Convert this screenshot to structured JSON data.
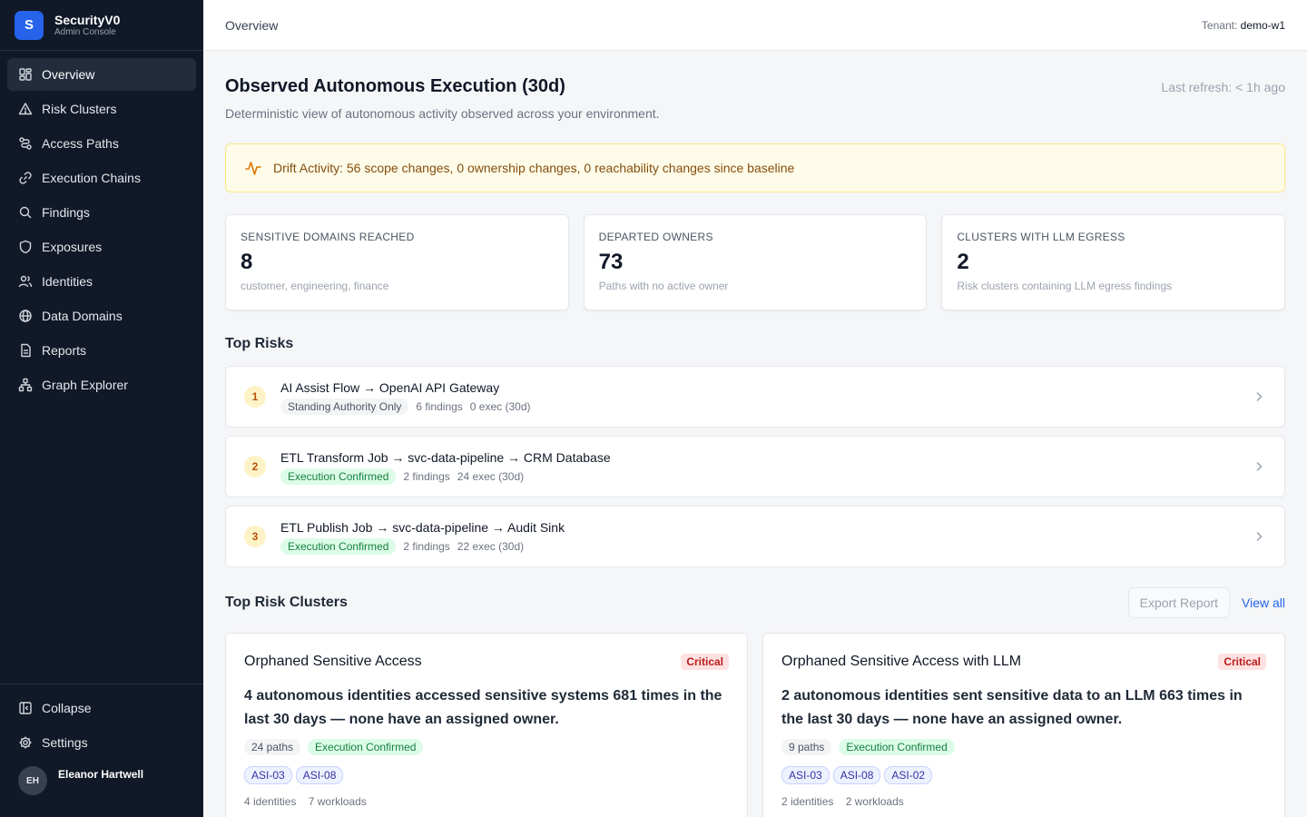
{
  "brand": {
    "logo": "S",
    "name": "SecurityV0",
    "subtitle": "Admin Console"
  },
  "sidebar": {
    "items": [
      {
        "label": "Overview",
        "icon": "dashboard-icon",
        "active": true
      },
      {
        "label": "Risk Clusters",
        "icon": "warning-triangle-icon"
      },
      {
        "label": "Access Paths",
        "icon": "route-icon"
      },
      {
        "label": "Execution Chains",
        "icon": "link-icon"
      },
      {
        "label": "Findings",
        "icon": "search-icon"
      },
      {
        "label": "Exposures",
        "icon": "shield-icon"
      },
      {
        "label": "Identities",
        "icon": "users-icon"
      },
      {
        "label": "Data Domains",
        "icon": "globe-icon"
      },
      {
        "label": "Reports",
        "icon": "document-icon"
      },
      {
        "label": "Graph Explorer",
        "icon": "network-icon"
      }
    ],
    "collapse_label": "Collapse",
    "settings_label": "Settings",
    "user": {
      "initials": "EH",
      "name": "Eleanor Hartwell"
    }
  },
  "header": {
    "breadcrumb": "Overview",
    "tenant_label": "Tenant:",
    "tenant_value": "demo-w1"
  },
  "page": {
    "title": "Observed Autonomous Execution (30d)",
    "subtitle": "Deterministic view of autonomous activity observed across your environment.",
    "last_refresh": "Last refresh: < 1h ago"
  },
  "drift": {
    "text": "Drift Activity: 56 scope changes, 0 ownership changes, 0 reachability changes since baseline",
    "icon": "activity-pulse-icon"
  },
  "stats": [
    {
      "label": "SENSITIVE DOMAINS REACHED",
      "value": "8",
      "desc": "customer, engineering, finance"
    },
    {
      "label": "DEPARTED OWNERS",
      "value": "73",
      "desc": "Paths with no active owner"
    },
    {
      "label": "CLUSTERS WITH LLM EGRESS",
      "value": "2",
      "desc": "Risk clusters containing LLM egress findings"
    }
  ],
  "top_risks": {
    "title": "Top Risks",
    "items": [
      {
        "rank": "1",
        "name": "AI Assist Flow → OpenAI API Gateway",
        "status": "Standing Authority Only",
        "status_type": "gray",
        "findings": "6 findings",
        "exec": "0 exec (30d)"
      },
      {
        "rank": "2",
        "name": "ETL Transform Job → svc-data-pipeline → CRM Database",
        "status": "Execution Confirmed",
        "status_type": "green",
        "findings": "2 findings",
        "exec": "24 exec (30d)"
      },
      {
        "rank": "3",
        "name": "ETL Publish Job → svc-data-pipeline → Audit Sink",
        "status": "Execution Confirmed",
        "status_type": "green",
        "findings": "2 findings",
        "exec": "22 exec (30d)"
      }
    ]
  },
  "clusters": {
    "title": "Top Risk Clusters",
    "export_label": "Export Report",
    "view_all_label": "View all",
    "items": [
      {
        "name": "Orphaned Sensitive Access",
        "severity": "Critical",
        "summary": "4 autonomous identities accessed sensitive systems 681 times in the last 30 days — none have an assigned owner.",
        "paths": "24 paths",
        "status": "Execution Confirmed",
        "asi": [
          "ASI-03",
          "ASI-08"
        ],
        "identities": "4 identities",
        "workloads": "7 workloads"
      },
      {
        "name": "Orphaned Sensitive Access with LLM",
        "severity": "Critical",
        "summary": "2 autonomous identities sent sensitive data to an LLM 663 times in the last 30 days — none have an assigned owner.",
        "paths": "9 paths",
        "status": "Execution Confirmed",
        "asi": [
          "ASI-03",
          "ASI-08",
          "ASI-02"
        ],
        "identities": "2 identities",
        "workloads": "2 workloads"
      }
    ]
  },
  "colors": {
    "sidebar_bg": "#111827",
    "accent": "#2563eb",
    "critical": "#b91c1c",
    "confirmed": "#15803d",
    "drift_bg": "#fefce8"
  }
}
